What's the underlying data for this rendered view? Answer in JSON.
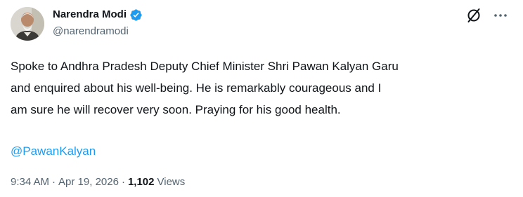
{
  "author": {
    "display_name": "Narendra Modi",
    "handle": "@narendramodi",
    "verified": true,
    "verified_color": "#1d9bf0"
  },
  "post": {
    "text": "Spoke to Andhra Pradesh Deputy Chief Minister Shri Pawan Kalyan Garu\nand enquired about his well-being. He is remarkably courageous and I\nam sure he will recover very soon. Praying for his good health.",
    "mention": "@PawanKalyan",
    "mention_color": "#1d9bf0"
  },
  "meta": {
    "time": "9:34 AM",
    "separator": "·",
    "date": "Apr 19, 2026",
    "views_count": "1,102",
    "views_label": "Views"
  },
  "icons": {
    "grok": "grok-icon",
    "more": "more-icon"
  }
}
